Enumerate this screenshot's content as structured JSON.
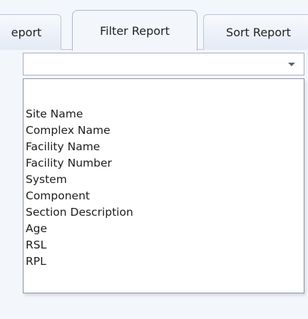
{
  "tabs": [
    {
      "label": "eport"
    },
    {
      "label": "Filter Report"
    },
    {
      "label": "Sort Report"
    }
  ],
  "combo": {
    "value": ""
  },
  "dropdown": {
    "items": [
      {
        "label": "Site Name"
      },
      {
        "label": "Complex Name"
      },
      {
        "label": "Facility Name"
      },
      {
        "label": "Facility Number"
      },
      {
        "label": "System"
      },
      {
        "label": "Component"
      },
      {
        "label": "Section Description"
      },
      {
        "label": "Age"
      },
      {
        "label": "RSL"
      },
      {
        "label": "RPL"
      }
    ]
  },
  "icons": {
    "combo_arrow": "dropdown-arrow-icon"
  }
}
